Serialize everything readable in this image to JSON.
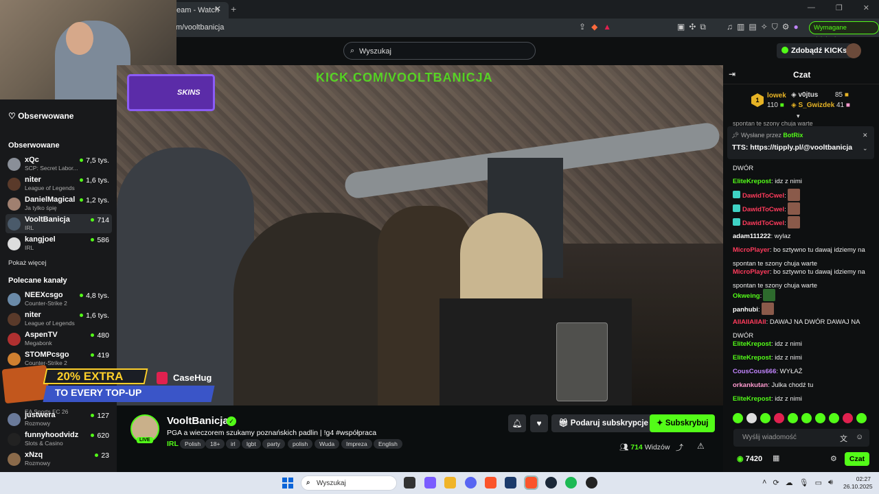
{
  "browser": {
    "tab_title": "eam - Watch",
    "tab_close": "✕",
    "new_tab": "+",
    "url": "m/vooltbanicja",
    "action_label": "Wymagane działanie",
    "window_controls": [
      "—",
      "❐",
      "✕"
    ]
  },
  "header": {
    "search_placeholder": "Wyszukaj",
    "kicks_label": "Zdobądź KICKs"
  },
  "sidebar": {
    "following_nav_label": "Obserwowane",
    "following_section": "Obserwowane",
    "following": [
      {
        "name": "xQc",
        "category": "SCP: Secret Labor...",
        "viewers": "7,5 tys."
      },
      {
        "name": "niter",
        "category": "League of Legends",
        "viewers": "1,6 tys."
      },
      {
        "name": "DanielMagical",
        "category": "Ja tylko śpię",
        "viewers": "1,2 tys."
      },
      {
        "name": "VooltBanicja",
        "category": "IRL",
        "viewers": "714"
      },
      {
        "name": "kangjoel",
        "category": "IRL",
        "viewers": "586"
      }
    ],
    "show_more": "Pokaż więcej",
    "recommended_section": "Polecane kanały",
    "recommended": [
      {
        "name": "NEEXcsgo",
        "category": "Counter-Strike 2",
        "viewers": "4,8 tys."
      },
      {
        "name": "niter",
        "category": "League of Legends",
        "viewers": "1,6 tys."
      },
      {
        "name": "AspenTV",
        "category": "Megabonk",
        "viewers": "480"
      },
      {
        "name": "STOMPcsgo",
        "category": "Counter-Strike 2",
        "viewers": "419"
      }
    ],
    "lower": [
      {
        "name": "",
        "category": "EA Sports FC 26",
        "viewers": ""
      },
      {
        "name": "justwera",
        "category": "Rozmowy",
        "viewers": "127"
      },
      {
        "name": "funnyhoodvidz",
        "category": "Slots & Casino",
        "viewers": "620"
      },
      {
        "name": "xNzq",
        "category": "Rozmowy",
        "viewers": "23"
      }
    ]
  },
  "video": {
    "overlay_text": "KICK.COM/VOOLTBANICJA",
    "skins_badge": "SKINS",
    "promo_line1": "20% EXTRA",
    "promo_line2": "TO EVERY TOP-UP",
    "promo_brand": "CaseHug"
  },
  "channel": {
    "name": "VooltBanicja",
    "live": "LIVE",
    "title": "PGA a wieczorem szukamy poznańskich padlin | !g4 #współpraca",
    "category": "IRL",
    "tags": [
      "Polish",
      "18+",
      "irl",
      "lgbt",
      "party",
      "polish",
      "Wuda",
      "Impreza",
      "English"
    ],
    "gift_label": "Podaruj subskrypcje",
    "subscribe_label": "Subskrybuj",
    "viewers_count": "714",
    "viewers_label": "Widzów"
  },
  "chat": {
    "title": "Czat",
    "leaders": {
      "rank": "1",
      "first_name": "lowek",
      "first_score": "110",
      "second_name": "v0jtus",
      "second_score": "85",
      "third_name": "S_Gwizdek",
      "third_score": "41"
    },
    "pinned_by_label": "Wysłane przez",
    "pinned_by": "BotRix",
    "pinned_message": "TTS: https://tipply.pl/@vooltbanicja",
    "partial_top": "spontan te szony chuja warte",
    "messages": [
      {
        "user": "",
        "text": "DWÓR",
        "color": "#ff4d4d"
      },
      {
        "user": "EliteKrepost",
        "text": "idz z nimi",
        "color": "#53fc18"
      },
      {
        "user": "DawidToCwel",
        "text": "",
        "color": "#ff3b5c"
      },
      {
        "user": "DawidToCwel",
        "text": "",
        "color": "#ff3b5c"
      },
      {
        "user": "DawidToCwel",
        "text": "",
        "color": "#ff3b5c"
      },
      {
        "user": "adam111222",
        "text": "wylaz",
        "color": "#ffffff"
      },
      {
        "user": "MicroPlayer",
        "text": "bo sztywno tu dawaj idziemy na spontan te szony chuja warte",
        "color": "#ff3b5c"
      },
      {
        "user": "MicroPlayer",
        "text": "bo sztywno tu dawaj idziemy na spontan te szony chuja warte",
        "color": "#ff3b5c"
      },
      {
        "user": "Okweing",
        "text": "",
        "color": "#53fc18"
      },
      {
        "user": "panhubi",
        "text": "",
        "color": "#ffffff"
      },
      {
        "user": "AlIAlIAlIAlI",
        "text": "DAWAJ NA DWÓR DAWAJ NA DWÓR",
        "color": "#ff3b5c"
      },
      {
        "user": "EliteKrepost",
        "text": "idz z nimi",
        "color": "#53fc18"
      },
      {
        "user": "EliteKrepost",
        "text": "idz z nimi",
        "color": "#53fc18"
      },
      {
        "user": "CousCous666",
        "text": "WYŁAŹ",
        "color": "#c084fc"
      },
      {
        "user": "orkankutan",
        "text": "Julka chodź tu",
        "color": "#ff9bd0"
      },
      {
        "user": "EliteKrepost",
        "text": "idz z nimi",
        "color": "#53fc18"
      }
    ],
    "input_placeholder": "Wyślij wiadomość",
    "points": "7420",
    "send_label": "Czat"
  },
  "taskbar": {
    "search_placeholder": "Wyszukaj",
    "time": "02:27",
    "date": "26.10.2025"
  }
}
